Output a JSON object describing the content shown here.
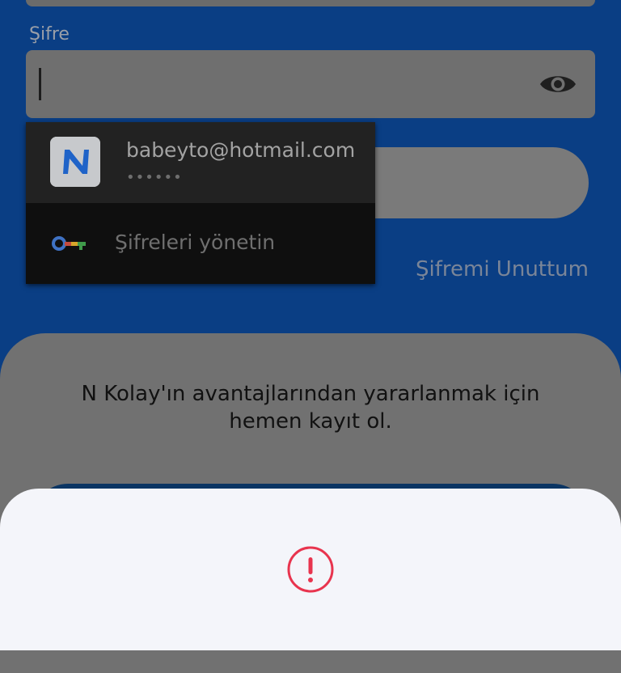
{
  "login": {
    "password_label": "Şifre",
    "password_value": "",
    "forgot_password": "Şifremi Unuttum"
  },
  "autofill": {
    "account_email": "babeyto@hotmail.com",
    "account_password_mask": "••••••",
    "manage_passwords": "Şifreleri yönetin"
  },
  "signup_card": {
    "line1": "N Kolay'ın avantajlarından yararlanmak için",
    "line2": "hemen kayıt ol."
  },
  "icons": {
    "visibility": "eye-icon",
    "app_logo": "n-kolay-logo",
    "key": "key-icon",
    "alert": "exclamation-circle-icon"
  },
  "colors": {
    "background": "#0a3e84",
    "alert_red": "#e8344e",
    "sheet": "#f4f5fa"
  }
}
